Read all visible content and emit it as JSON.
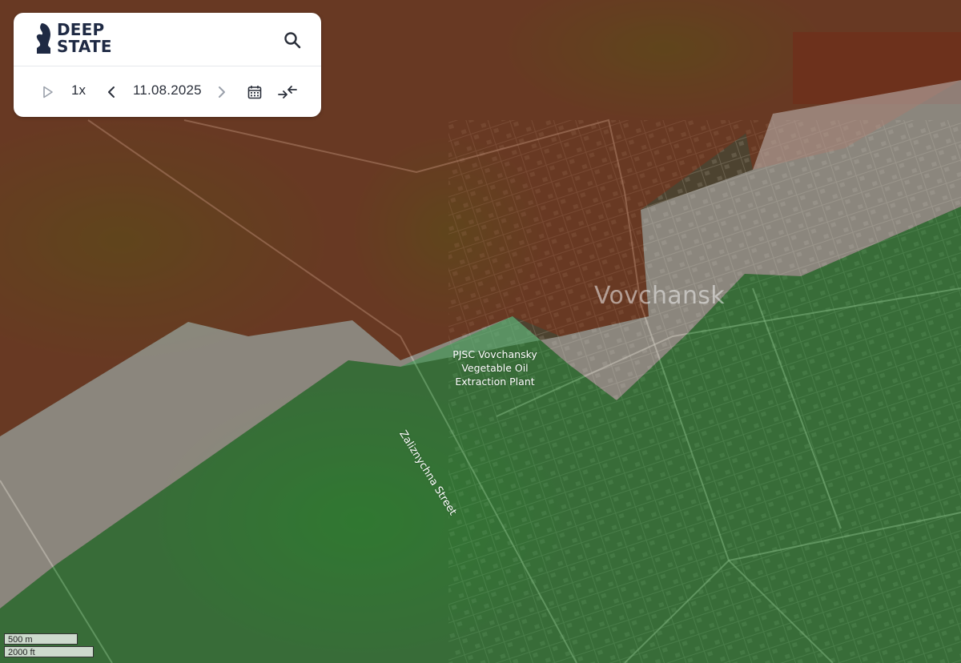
{
  "app": {
    "logo_line1": "DEEP",
    "logo_line2": "STATE"
  },
  "controls": {
    "speed": "1x",
    "date": "11.08.2025"
  },
  "map_labels": {
    "city": "Vovchansk",
    "plant": [
      "PJSC Vovchansky",
      "Vegetable Oil",
      "Extraction Plant"
    ],
    "street": "Zaliznychna Street"
  },
  "scale": {
    "metric": "500 m",
    "imperial": "2000 ft"
  },
  "colors": {
    "occupied_zone": "#7a2a10",
    "grey_zone": "#b8b8b8",
    "liberated_zone": "#1f9a3f",
    "logo": "#1f2a44"
  },
  "icons": [
    "knight-logo-icon",
    "search-icon",
    "play-icon",
    "chevron-left-icon",
    "chevron-right-icon",
    "calendar-icon",
    "collapse-arrows-icon"
  ]
}
